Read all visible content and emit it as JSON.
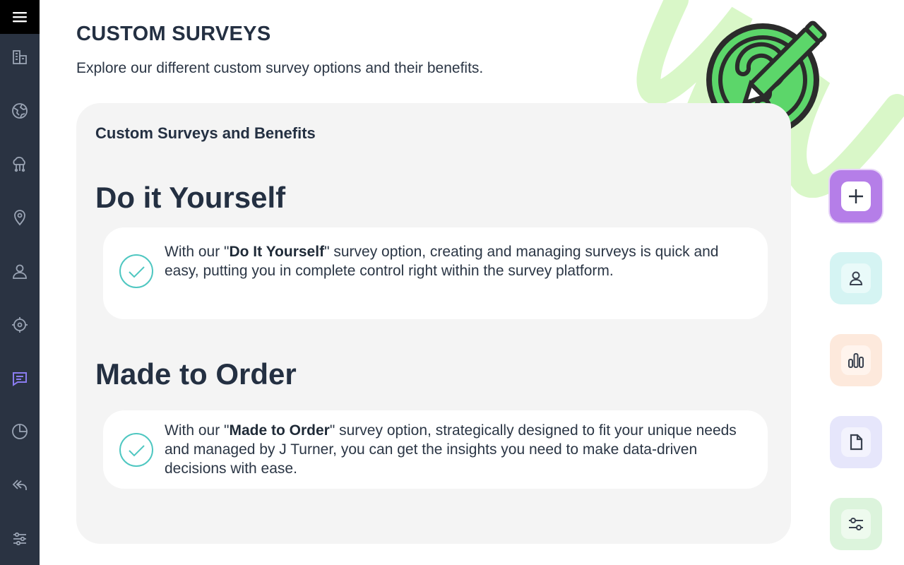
{
  "header": {
    "title": "CUSTOM SURVEYS",
    "subtitle": "Explore our different custom survey options and their benefits."
  },
  "card": {
    "title": "Custom Surveys and Benefits",
    "sections": [
      {
        "heading": "Do it Yourself",
        "text_before": "With our \"",
        "text_bold": "Do It Yourself",
        "text_after": "\" survey option, creating and managing surveys is quick and easy, putting you in complete control right within the survey platform."
      },
      {
        "heading": "Made to Order",
        "text_before": "With our \"",
        "text_bold": "Made to Order",
        "text_after": "\" survey option, strategically designed to fit your unique needs and managed by J Turner, you can get the insights you need to make data-driven decisions with ease."
      }
    ]
  },
  "sidebar": {
    "active_item": "messages",
    "items": [
      "menu-icon",
      "building-icon",
      "globe-icon",
      "cloud-network-icon",
      "location-pin-icon",
      "user-icon",
      "target-icon",
      "message-icon",
      "pie-chart-icon",
      "reply-icon",
      "sliders-icon"
    ]
  },
  "actions": [
    {
      "name": "add",
      "icon": "plus-icon",
      "bg": "#b57ee8",
      "inner": "#ffffff"
    },
    {
      "name": "user",
      "icon": "user-icon",
      "bg": "#d5f4f3",
      "inner": "#e9faf9"
    },
    {
      "name": "chart",
      "icon": "bar-chart-icon",
      "bg": "#fde9dc",
      "inner": "#fff4ed"
    },
    {
      "name": "document",
      "icon": "document-icon",
      "bg": "#e6e6fb",
      "inner": "#f3f3fd"
    },
    {
      "name": "settings",
      "icon": "sliders-icon",
      "bg": "#dcf4dc",
      "inner": "#eefaee"
    }
  ],
  "colors": {
    "sidebar": "#2a3342",
    "accent_active": "#8a7cf0",
    "check": "#4fc7c1",
    "decoration_green": "#5cd66a",
    "decoration_light": "#d9f7c8"
  }
}
